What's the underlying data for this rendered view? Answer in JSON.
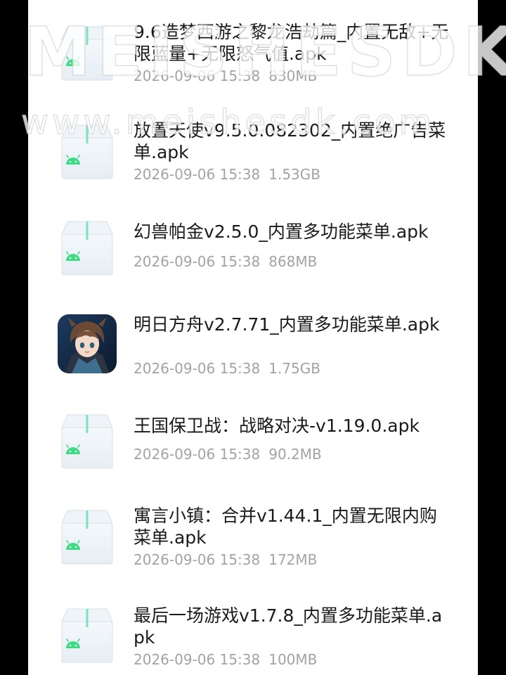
{
  "colors": {
    "background": "#000000",
    "panel": "#ffffff",
    "title_text": "#1a1a1a",
    "meta_text": "#a3a3a3",
    "android_green": "#3ddc84"
  },
  "watermark": {
    "line1": "MEISHESDK",
    "line2": "www.meishesdk.com"
  },
  "files": [
    {
      "title": "9.6造梦西游之黎龙浩劫篇_内置无敌+无限蓝量+无限怒气值.apk",
      "date": "2026-09-06 15:38",
      "size": "830MB",
      "icon": "android-apk-icon"
    },
    {
      "title": "放置天使v9.5.0.082302_内置绝广告菜单.apk",
      "date": "2026-09-06 15:38",
      "size": "1.53GB",
      "icon": "android-apk-icon"
    },
    {
      "title": "幻兽帕金v2.5.0_内置多功能菜单.apk",
      "date": "2026-09-06 15:38",
      "size": "868MB",
      "icon": "android-apk-icon"
    },
    {
      "title": "明日方舟v2.7.71_内置多功能菜单.apk",
      "date": "2026-09-06 15:38",
      "size": "1.75GB",
      "icon": "game-app-icon"
    },
    {
      "title": "王国保卫战：战略对决-v1.19.0.apk",
      "date": "2026-09-06 15:38",
      "size": "90.2MB",
      "icon": "android-apk-icon"
    },
    {
      "title": "寓言小镇：合并v1.44.1_内置无限内购菜单.apk",
      "date": "2026-09-06 15:38",
      "size": "172MB",
      "icon": "android-apk-icon"
    },
    {
      "title": "最后一场游戏v1.7.8_内置多功能菜单.apk",
      "date": "2026-09-06 15:38",
      "size": "100MB",
      "icon": "android-apk-icon"
    }
  ]
}
